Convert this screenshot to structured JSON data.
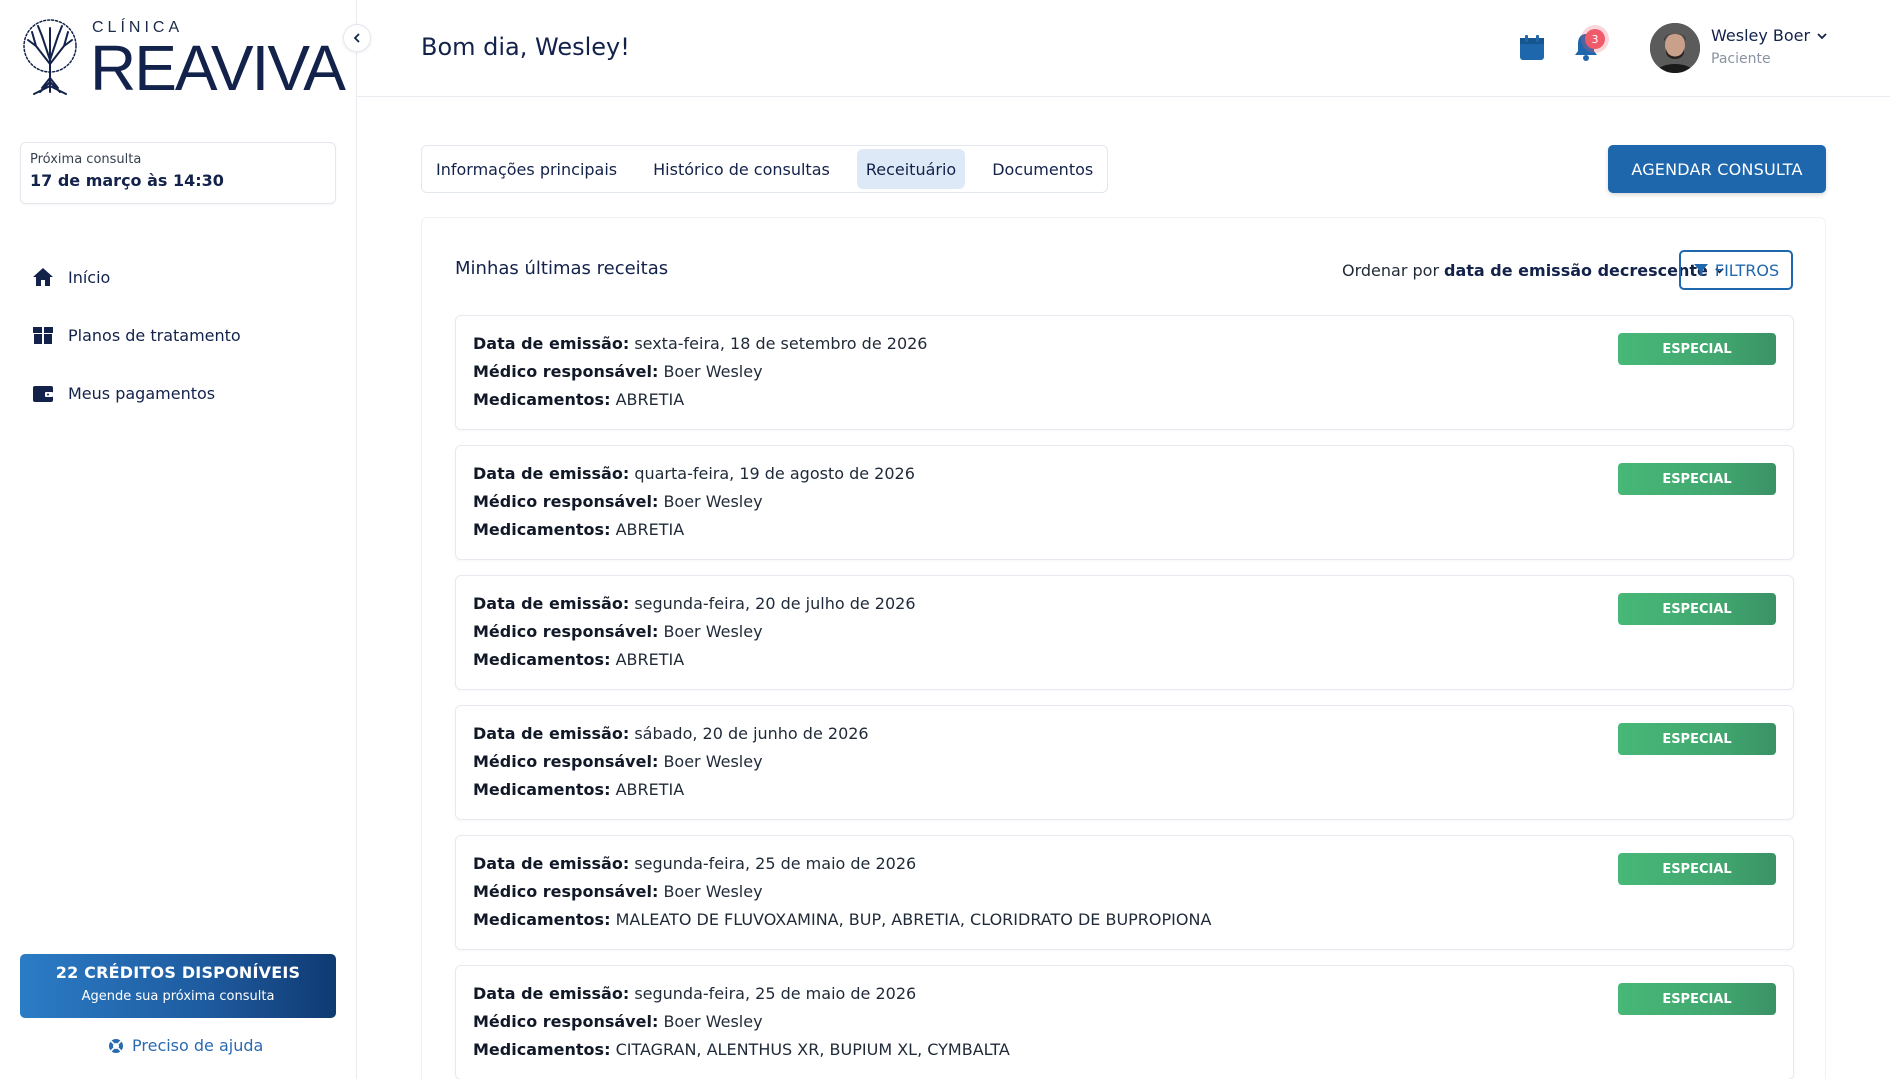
{
  "brand": {
    "prefix": "CLÍNICA",
    "name": "REAVIVA"
  },
  "sidebar": {
    "next_appointment": {
      "label": "Próxima consulta",
      "value": "17 de março às 14:30"
    },
    "items": [
      {
        "label": "Início",
        "icon": "home-icon"
      },
      {
        "label": "Planos de tratamento",
        "icon": "box-icon"
      },
      {
        "label": "Meus pagamentos",
        "icon": "wallet-icon"
      }
    ],
    "credits": {
      "title": "22 CRÉDITOS DISPONÍVEIS",
      "subtitle": "Agende sua próxima consulta"
    },
    "help": "Preciso de ajuda"
  },
  "header": {
    "greeting": "Bom dia, Wesley!",
    "notifications_count": "3",
    "user": {
      "name": "Wesley Boer",
      "role": "Paciente"
    }
  },
  "tabs": [
    {
      "label": "Informações principais",
      "active": false
    },
    {
      "label": "Histórico de consultas",
      "active": false
    },
    {
      "label": "Receituário",
      "active": true
    },
    {
      "label": "Documentos",
      "active": false
    }
  ],
  "cta": "AGENDAR CONSULTA",
  "panel": {
    "title": "Minhas últimas receitas",
    "sort_prefix": "Ordenar por",
    "sort_value": "data de emissão decrescente",
    "filters": "FILTROS",
    "labels": {
      "date": "Data de emissão:",
      "doctor": "Médico responsável:",
      "meds": "Medicamentos:"
    },
    "prescriptions": [
      {
        "date": "sexta-feira, 18 de setembro de 2026",
        "doctor": "Boer Wesley",
        "meds": "ABRETIA",
        "badge": "ESPECIAL"
      },
      {
        "date": "quarta-feira, 19 de agosto de 2026",
        "doctor": "Boer Wesley",
        "meds": "ABRETIA",
        "badge": "ESPECIAL"
      },
      {
        "date": "segunda-feira, 20 de julho de 2026",
        "doctor": "Boer Wesley",
        "meds": "ABRETIA",
        "badge": "ESPECIAL"
      },
      {
        "date": "sábado, 20 de junho de 2026",
        "doctor": "Boer Wesley",
        "meds": "ABRETIA",
        "badge": "ESPECIAL"
      },
      {
        "date": "segunda-feira, 25 de maio de 2026",
        "doctor": "Boer Wesley",
        "meds": "MALEATO DE FLUVOXAMINA, BUP, ABRETIA, CLORIDRATO DE BUPROPIONA",
        "badge": "ESPECIAL"
      },
      {
        "date": "segunda-feira, 25 de maio de 2026",
        "doctor": "Boer Wesley",
        "meds": "CITAGRAN, ALENTHUS XR, BUPIUM XL, CYMBALTA",
        "badge": "ESPECIAL"
      }
    ]
  },
  "colors": {
    "primary": "#1f67ad",
    "navy": "#13224a",
    "success": "#47b877",
    "badge_red": "#ef5b6a"
  }
}
